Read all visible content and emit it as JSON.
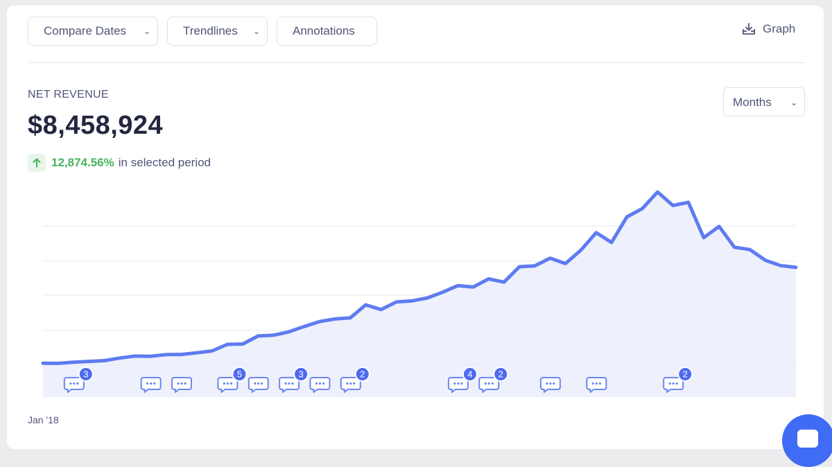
{
  "toolbar": {
    "compare_dates": "Compare Dates",
    "trendlines": "Trendlines",
    "annotations": "Annotations",
    "graph": "Graph"
  },
  "metric": {
    "label": "NET REVENUE",
    "value": "$8,458,924",
    "change_pct": "12,874.56%",
    "change_text": "in selected period"
  },
  "period_select": {
    "selected": "Months"
  },
  "colors": {
    "line": "#5e7cf0",
    "area": "#eef0fc",
    "grid": "#e8e9ef",
    "badge": "#4f6bf2",
    "icon": "#6b86f2"
  },
  "chart_data": {
    "type": "area",
    "x_start_label": "Jan '18",
    "values": [
      0.16,
      0.15,
      0.3,
      0.4,
      0.5,
      0.85,
      1.1,
      1.08,
      1.3,
      1.31,
      1.53,
      1.78,
      2.65,
      2.69,
      3.75,
      3.85,
      4.3,
      5.0,
      5.65,
      6.0,
      6.14,
      7.85,
      7.23,
      8.23,
      8.37,
      8.75,
      9.51,
      10.39,
      10.2,
      11.27,
      10.84,
      12.87,
      12.99,
      14.0,
      13.29,
      15.05,
      17.36,
      16.07,
      19.44,
      20.53,
      22.72,
      20.94,
      21.36,
      16.7,
      18.18,
      15.44,
      15.13,
      13.73,
      13.02,
      12.79
    ]
  },
  "annotations": [
    {
      "month_index": 2,
      "count": "3"
    },
    {
      "month_index": 7,
      "count": ""
    },
    {
      "month_index": 9,
      "count": ""
    },
    {
      "month_index": 12,
      "count": "5"
    },
    {
      "month_index": 14,
      "count": ""
    },
    {
      "month_index": 16,
      "count": "3"
    },
    {
      "month_index": 18,
      "count": ""
    },
    {
      "month_index": 20,
      "count": "2"
    },
    {
      "month_index": 27,
      "count": "4"
    },
    {
      "month_index": 29,
      "count": "2"
    },
    {
      "month_index": 33,
      "count": ""
    },
    {
      "month_index": 36,
      "count": ""
    },
    {
      "month_index": 41,
      "count": "2"
    }
  ]
}
